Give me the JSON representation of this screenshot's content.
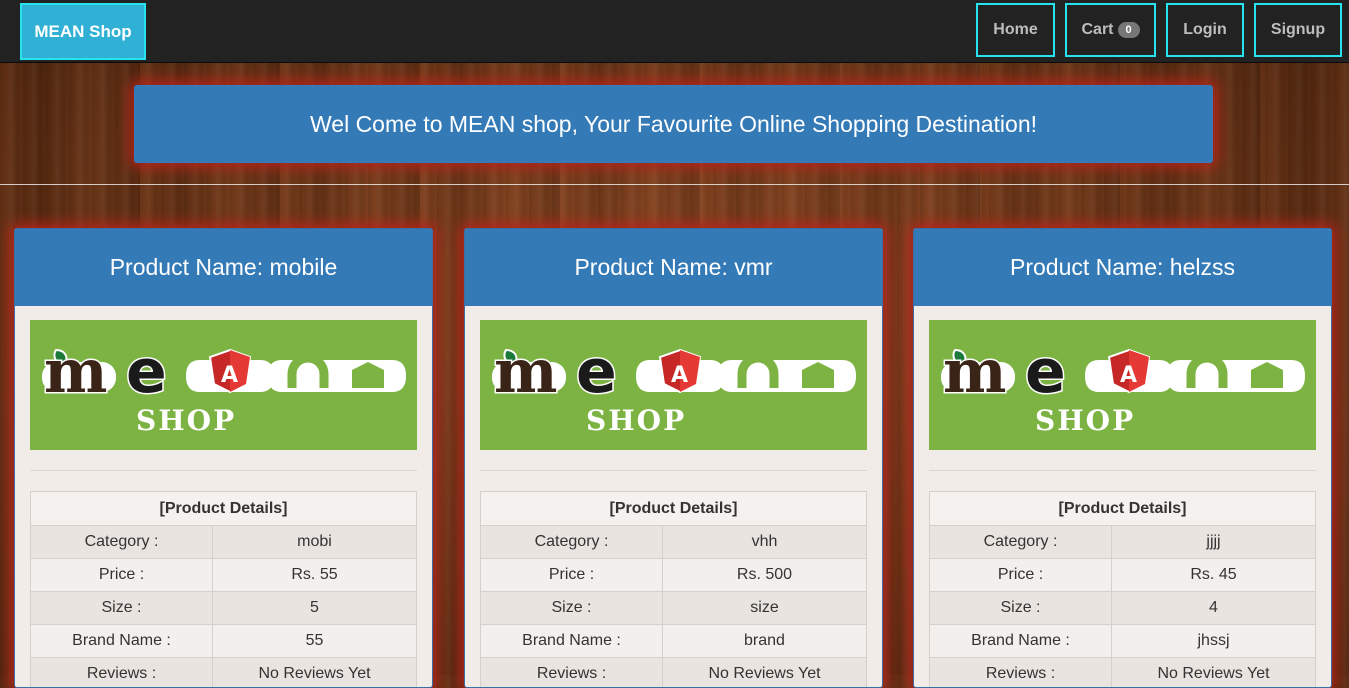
{
  "nav": {
    "brand": "MEAN Shop",
    "home": "Home",
    "cart": "Cart",
    "cart_count": "0",
    "login": "Login",
    "signup": "Signup"
  },
  "banner": {
    "text": "Wel Come to MEAN shop, Your Favourite Online Shopping Destination!"
  },
  "logo": {
    "wordmark": "mean",
    "subtitle": "SHOP",
    "bg_color": "#7cb342"
  },
  "colors": {
    "primary": "#337ab7",
    "brand": "#31b0d5",
    "accent_border": "#27e3f0",
    "glow": "#b8241a"
  },
  "products": [
    {
      "title": "Product Name: mobile",
      "details_header": "[Product Details]",
      "rows": [
        {
          "label": "Category :",
          "value": "mobi"
        },
        {
          "label": "Price :",
          "value": "Rs. 55"
        },
        {
          "label": "Size :",
          "value": "5"
        },
        {
          "label": "Brand Name :",
          "value": "55"
        },
        {
          "label": "Reviews :",
          "value": "No Reviews Yet"
        }
      ]
    },
    {
      "title": "Product Name: vmr",
      "details_header": "[Product Details]",
      "rows": [
        {
          "label": "Category :",
          "value": "vhh"
        },
        {
          "label": "Price :",
          "value": "Rs. 500"
        },
        {
          "label": "Size :",
          "value": "size"
        },
        {
          "label": "Brand Name :",
          "value": "brand"
        },
        {
          "label": "Reviews :",
          "value": "No Reviews Yet"
        }
      ]
    },
    {
      "title": "Product Name: helzss",
      "details_header": "[Product Details]",
      "rows": [
        {
          "label": "Category :",
          "value": "jjjj"
        },
        {
          "label": "Price :",
          "value": "Rs. 45"
        },
        {
          "label": "Size :",
          "value": "4"
        },
        {
          "label": "Brand Name :",
          "value": "jhssj"
        },
        {
          "label": "Reviews :",
          "value": "No Reviews Yet"
        }
      ]
    }
  ]
}
